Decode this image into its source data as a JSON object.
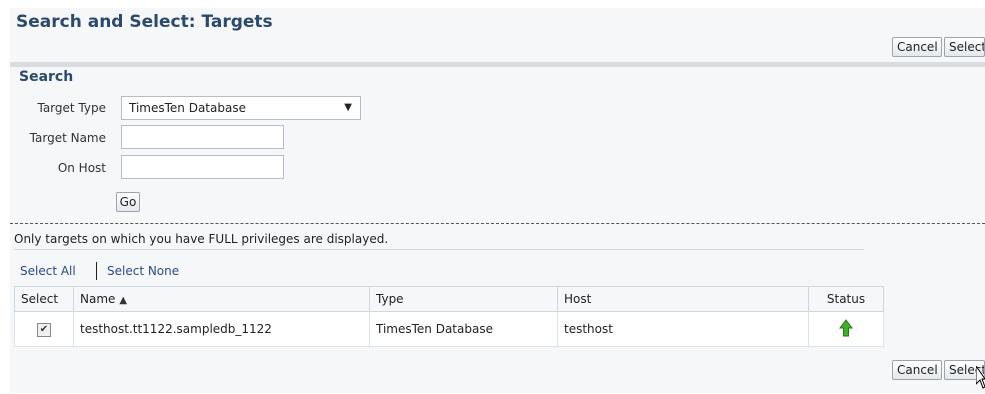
{
  "page": {
    "title": "Search and Select: Targets",
    "cancel_label": "Cancel",
    "select_label": "Select"
  },
  "search": {
    "heading": "Search",
    "target_type_label": "Target Type",
    "target_type_value": "TimesTen Database",
    "target_name_label": "Target Name",
    "target_name_value": "",
    "on_host_label": "On Host",
    "on_host_value": "",
    "go_label": "Go"
  },
  "results": {
    "privilege_note": "Only targets on which you have FULL privileges are displayed.",
    "select_all": "Select All",
    "select_none": "Select None",
    "columns": {
      "select": "Select",
      "name": "Name",
      "type": "Type",
      "host": "Host",
      "status": "Status"
    },
    "rows": [
      {
        "checked": true,
        "name": "testhost.tt1122.sampledb_1122",
        "type": "TimesTen Database",
        "host": "testhost",
        "status": "up-arrow-icon"
      }
    ]
  },
  "colors": {
    "title": "#2b4a6e",
    "link": "#2b4a8e",
    "status_up": "#3fae2a"
  }
}
